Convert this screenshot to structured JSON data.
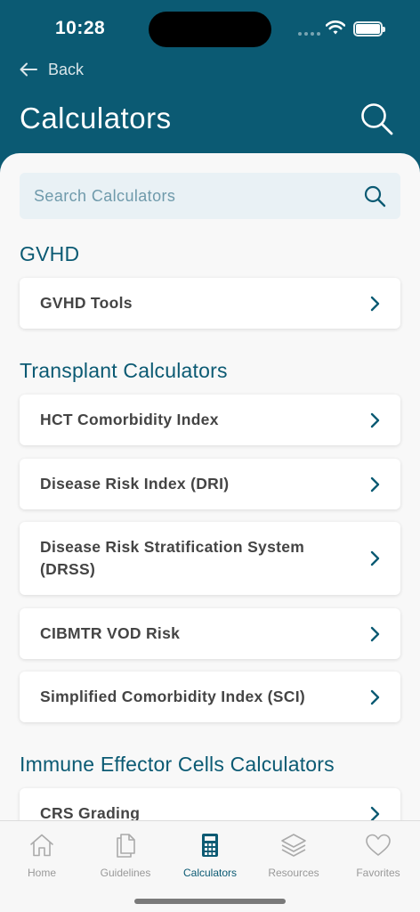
{
  "status_bar": {
    "time": "10:28"
  },
  "header": {
    "back_label": "Back",
    "title": "Calculators"
  },
  "search": {
    "placeholder": "Search Calculators"
  },
  "sections": [
    {
      "title": "GVHD",
      "items": [
        {
          "label": "GVHD Tools"
        }
      ]
    },
    {
      "title": "Transplant Calculators",
      "items": [
        {
          "label": "HCT Comorbidity Index"
        },
        {
          "label": "Disease Risk Index (DRI)"
        },
        {
          "label": "Disease Risk Stratification System (DRSS)"
        },
        {
          "label": "CIBMTR VOD Risk"
        },
        {
          "label": "Simplified Comorbidity Index (SCI)"
        }
      ]
    },
    {
      "title": "Immune Effector Cells Calculators",
      "items": [
        {
          "label": "CRS Grading"
        }
      ]
    }
  ],
  "tab_bar": {
    "tabs": [
      {
        "label": "Home",
        "icon": "home-icon",
        "active": false
      },
      {
        "label": "Guidelines",
        "icon": "documents-icon",
        "active": false
      },
      {
        "label": "Calculators",
        "icon": "calculator-icon",
        "active": true
      },
      {
        "label": "Resources",
        "icon": "layers-icon",
        "active": false
      },
      {
        "label": "Favorites",
        "icon": "heart-icon",
        "active": false
      }
    ]
  },
  "colors": {
    "brand": "#0b5a73",
    "background": "#f8f8f8",
    "search_bg": "#e9f1f5",
    "inactive_tab": "#999999"
  }
}
